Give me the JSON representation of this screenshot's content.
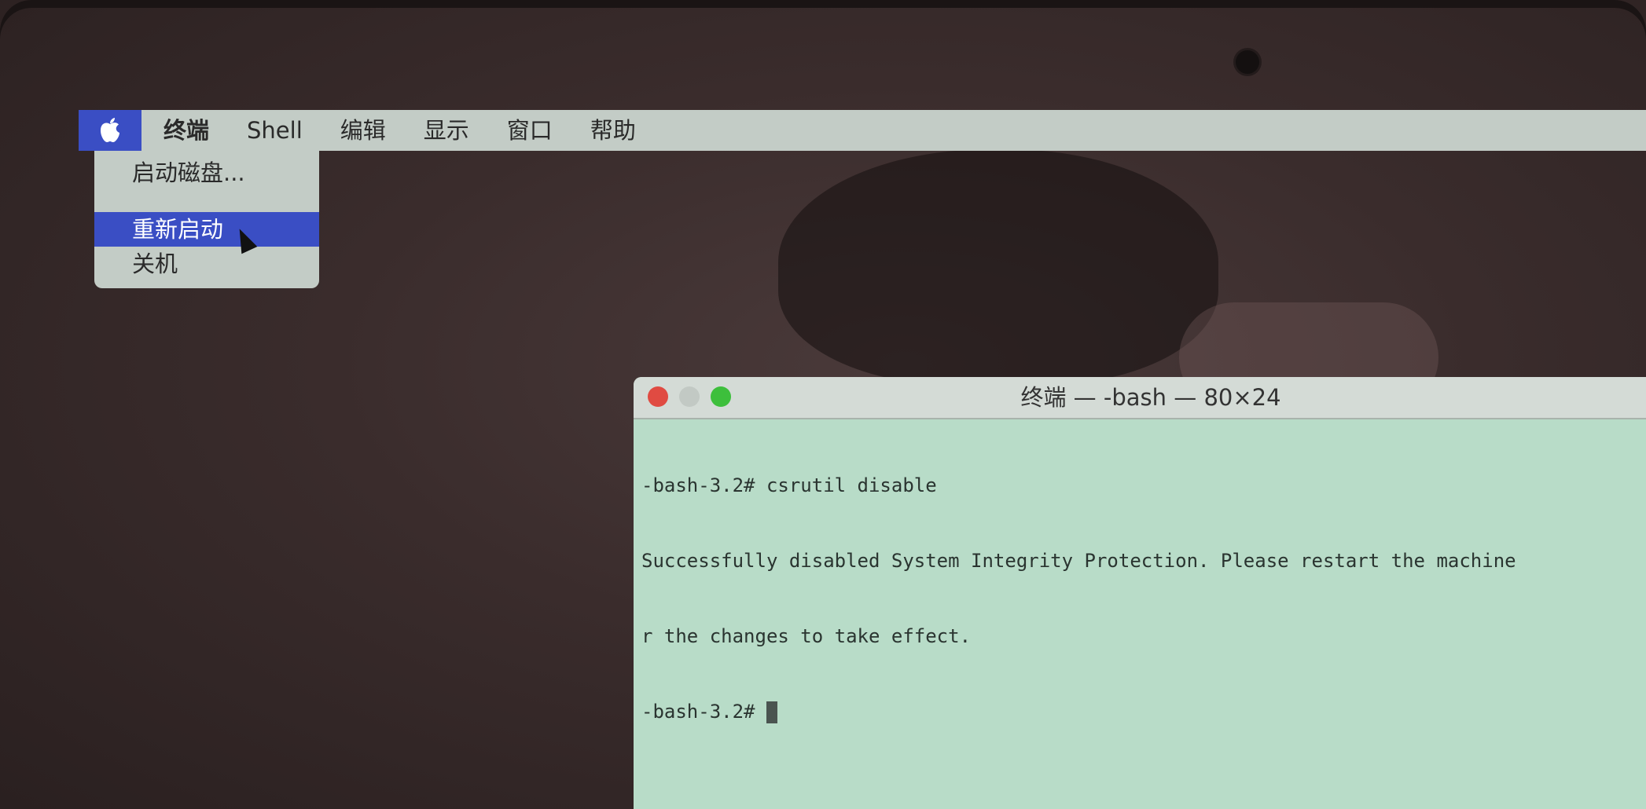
{
  "menubar": {
    "apple_icon": "apple-icon",
    "items": [
      "终端",
      "Shell",
      "编辑",
      "显示",
      "窗口",
      "帮助"
    ]
  },
  "apple_dropdown": {
    "items": [
      {
        "label": "启动磁盘...",
        "selected": false
      },
      {
        "label": "重新启动",
        "selected": true
      },
      {
        "label": "关机",
        "selected": false
      }
    ]
  },
  "terminal": {
    "title": "终端 — -bash — 80×24",
    "lines": [
      "-bash-3.2# csrutil disable",
      "Successfully disabled System Integrity Protection. Please restart the machine",
      "r the changes to take effect.",
      "-bash-3.2# "
    ]
  },
  "colors": {
    "menu_highlight": "#3a4ec4",
    "menubar_bg": "#c3ccc6",
    "terminal_bg": "#b8dcc8",
    "close_button": "#e04b42",
    "zoom_button": "#3dbf3c"
  }
}
